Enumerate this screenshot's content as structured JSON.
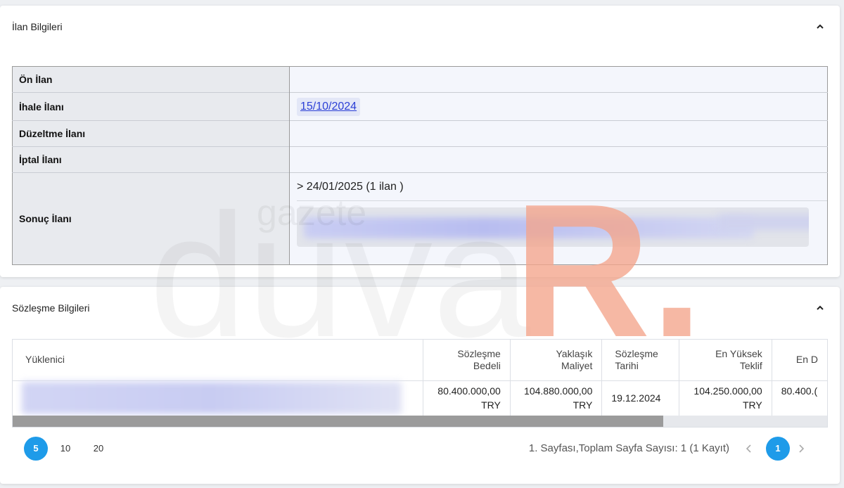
{
  "ilan": {
    "title": "İlan Bilgileri",
    "rows": [
      {
        "label": "Ön İlan",
        "value": ""
      },
      {
        "label": "İhale İlanı",
        "value": "15/10/2024"
      },
      {
        "label": "Düzeltme İlanı",
        "value": ""
      },
      {
        "label": "İptal İlanı",
        "value": ""
      },
      {
        "label": "Sonuç İlanı",
        "value": "> 24/01/2025 (1 ilan )"
      }
    ]
  },
  "sozlesme": {
    "title": "Sözleşme Bilgileri",
    "headers": [
      "Yüklenici",
      "Sözleşme Bedeli",
      "Yaklaşık Maliyet",
      "Sözleşme Tarihi",
      "En Yüksek Teklif",
      "En D"
    ],
    "row": {
      "yuklenici": "",
      "bedel": "80.400.000,00",
      "bedel_cur": "TRY",
      "maliyet": "104.880.000,00",
      "maliyet_cur": "TRY",
      "tarih": "19.12.2024",
      "yuksek": "104.250.000,00",
      "yuksek_cur": "TRY",
      "dusuk": "80.400.("
    },
    "page_sizes": [
      "5",
      "10",
      "20"
    ],
    "active_page_size": "5",
    "page_info": "1. Sayfası,Toplam Sayfa Sayısı: 1 (1 Kayıt)",
    "current_page": "1"
  },
  "watermark": {
    "small": "gazete",
    "large": "duva",
    "accent": "R.",
    "accent_color": "#f4a48a"
  },
  "colors": {
    "primary": "#1e9be9",
    "link": "#2b3fd6"
  },
  "icons": {
    "collapse": "chevron-up-icon",
    "prev": "chevron-left-icon",
    "next": "chevron-right-icon"
  }
}
